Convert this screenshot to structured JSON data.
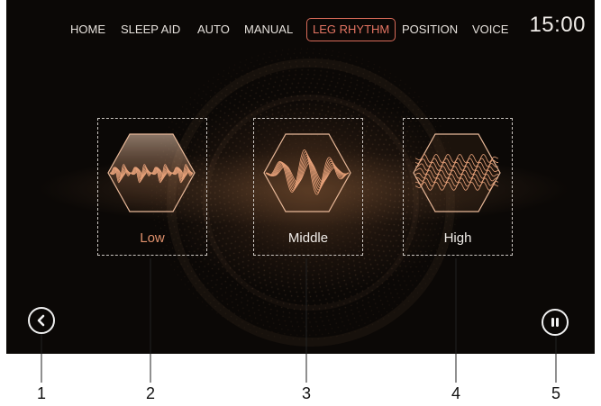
{
  "nav": {
    "tabs": [
      {
        "label": "HOME"
      },
      {
        "label": "SLEEP AID"
      },
      {
        "label": "AUTO"
      },
      {
        "label": "MANUAL"
      },
      {
        "label": "LEG RHYTHM",
        "active": true
      },
      {
        "label": "POSITION"
      },
      {
        "label": "VOICE"
      }
    ],
    "clock": "15:00"
  },
  "modes": [
    {
      "label": "Low",
      "selected": true,
      "icon": "low-wave-hexagon-icon"
    },
    {
      "label": "Middle",
      "selected": false,
      "icon": "middle-wave-hexagon-icon"
    },
    {
      "label": "High",
      "selected": false,
      "icon": "high-wave-hexagon-icon"
    }
  ],
  "controls": {
    "back_icon": "chevron-left-icon",
    "pause_icon": "pause-icon"
  },
  "callouts": [
    "1",
    "2",
    "3",
    "4",
    "5"
  ],
  "colors": {
    "background": "#0b0806",
    "accent": "#e47563",
    "wave": "#e8a27a",
    "text": "#e6e1dc"
  }
}
